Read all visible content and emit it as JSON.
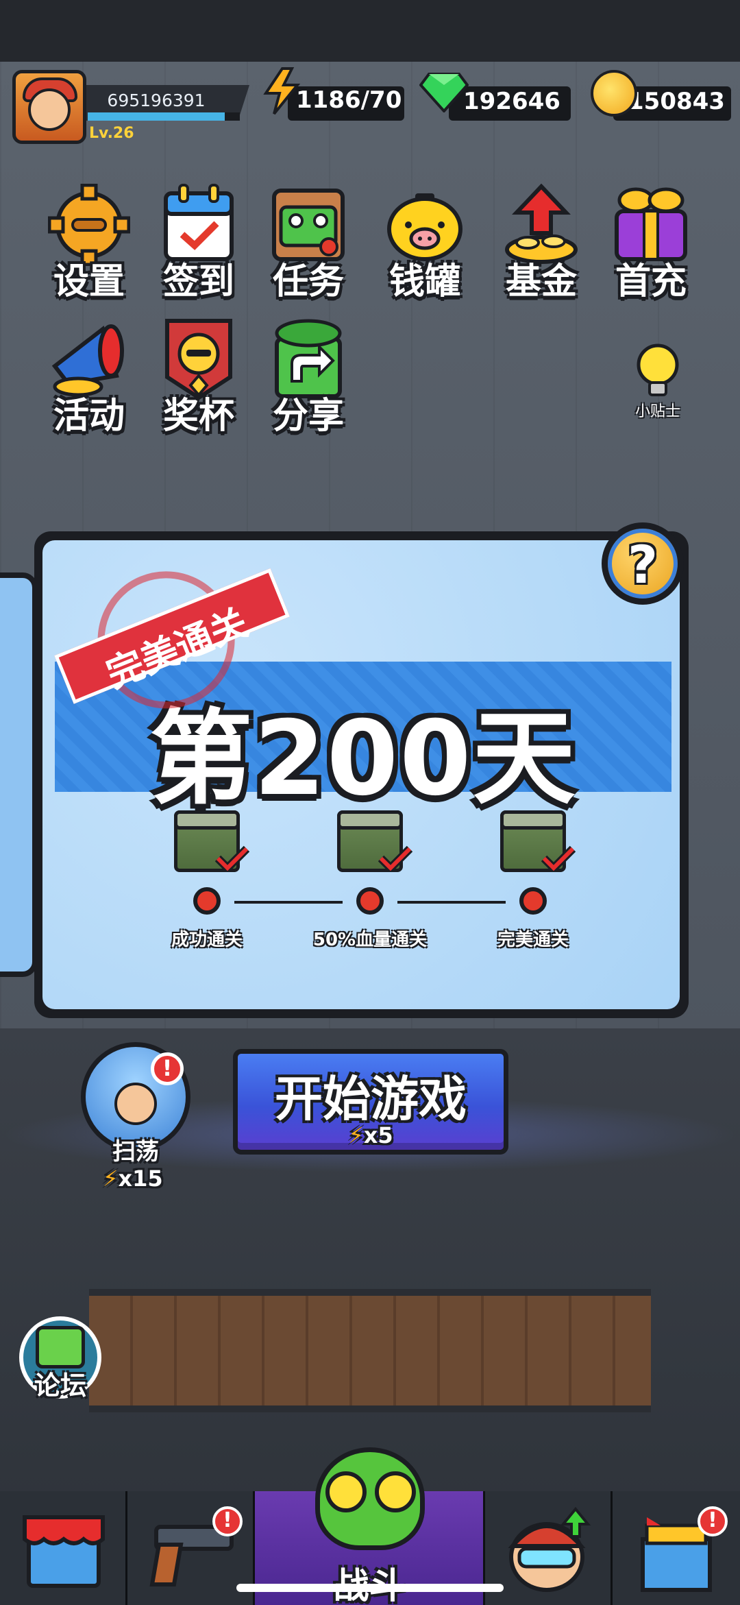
{
  "header": {
    "player_id": "695196391",
    "level": "Lv.26",
    "xp_fraction": 0.9,
    "energy": "1186/70",
    "gems": "192646",
    "coins": "150843"
  },
  "menu": [
    {
      "label": "设置",
      "icon": "gear-icon"
    },
    {
      "label": "签到",
      "icon": "calendar-icon"
    },
    {
      "label": "任务",
      "icon": "task-board-icon"
    },
    {
      "label": "钱罐",
      "icon": "piggy-bank-icon"
    },
    {
      "label": "基金",
      "icon": "fund-icon"
    },
    {
      "label": "首充",
      "icon": "gift-box-icon"
    },
    {
      "label": "活动",
      "icon": "megaphone-icon"
    },
    {
      "label": "奖杯",
      "icon": "trophy-icon"
    },
    {
      "label": "分享",
      "icon": "share-icon"
    }
  ],
  "tips": {
    "label": "小贴士",
    "icon": "lightbulb-icon"
  },
  "level_card": {
    "stamp": "完美通关",
    "title": "第200天",
    "help": "?",
    "goals": [
      {
        "label": "成功通关",
        "completed": true
      },
      {
        "label": "50%血量通关",
        "completed": true
      },
      {
        "label": "完美通关",
        "completed": true
      }
    ]
  },
  "actions": {
    "sweep_label": "扫荡",
    "sweep_cost": "x15",
    "sweep_alert": "!",
    "start_label": "开始游戏",
    "start_cost": "x5",
    "forum_label": "论坛"
  },
  "bottom_nav": {
    "battle_label": "战斗",
    "alert": "!"
  },
  "colors": {
    "accent_blue": "#3f8fe6",
    "stamp_red": "#e0323d",
    "energy_yellow": "#ffb21f",
    "gem_green": "#34d35a",
    "coin_gold": "#f2a81e",
    "active_tab_purple": "#6a3bb0"
  }
}
